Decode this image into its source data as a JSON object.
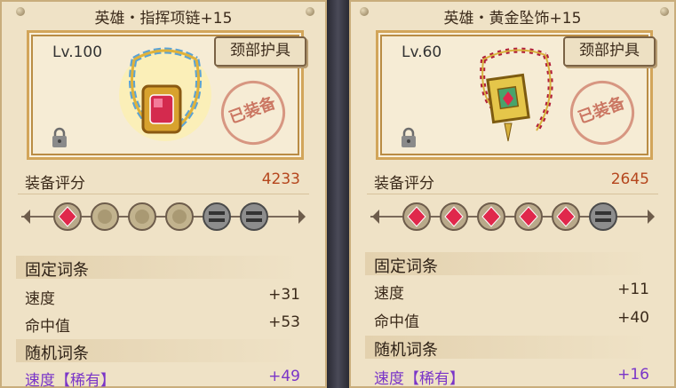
{
  "colors": {
    "score": "#b5461d",
    "rare": "#7a35c8",
    "parchment": "#efe2c6"
  },
  "left": {
    "title": "英雄・指挥项链+15",
    "level": "Lv.100",
    "slot": "颈部护具",
    "equipped": "已装备",
    "score_label": "装备评分",
    "score": "4233",
    "gems": [
      "ruby",
      "empty",
      "empty",
      "empty",
      "locked",
      "locked"
    ],
    "fixed_header": "固定词条",
    "fixed": [
      {
        "name": "速度",
        "value": "+31"
      },
      {
        "name": "命中值",
        "value": "+53"
      }
    ],
    "random_header": "随机词条",
    "random": [
      {
        "name": "速度【稀有】",
        "value": "+49"
      }
    ]
  },
  "right": {
    "title": "英雄・黄金坠饰+15",
    "level": "Lv.60",
    "slot": "颈部护具",
    "equipped": "已装备",
    "score_label": "装备评分",
    "score": "2645",
    "gems": [
      "ruby",
      "ruby",
      "ruby",
      "ruby",
      "ruby",
      "locked"
    ],
    "fixed_header": "固定词条",
    "fixed": [
      {
        "name": "速度",
        "value": "+11"
      },
      {
        "name": "命中值",
        "value": "+40"
      }
    ],
    "random_header": "随机词条",
    "random": [
      {
        "name": "速度【稀有】",
        "value": "+16"
      }
    ]
  }
}
